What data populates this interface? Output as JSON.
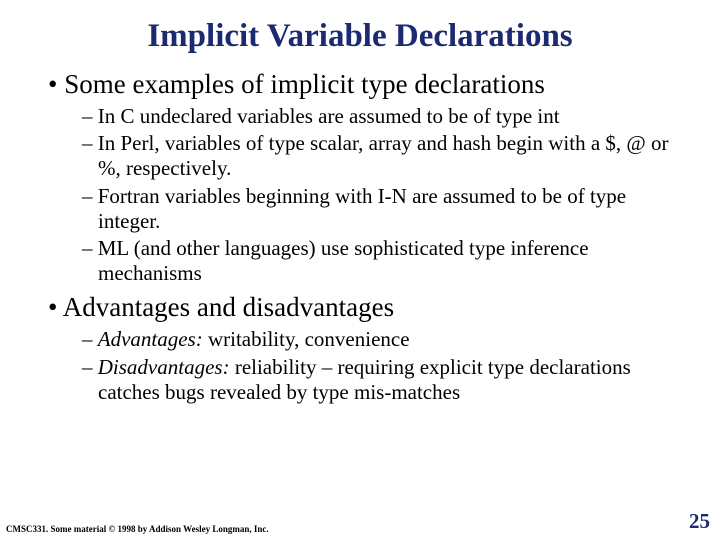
{
  "title": "Implicit Variable Declarations",
  "bullets": {
    "b1": "Some examples of implicit type declarations",
    "b1subs": {
      "s1": "In C undeclared variables are assumed to be of type int",
      "s2": "In Perl, variables of type scalar, array and hash begin with a $, @ or %, respectively.",
      "s3": "Fortran variables beginning with I-N are assumed to be of type integer.",
      "s4": "ML (and other languages) use sophisticated type inference mechanisms"
    },
    "b2": "Advantages and disadvantages",
    "b2subs": {
      "s1_label": "Advantages:",
      "s1_rest": " writability, convenience",
      "s2_label": "Disadvantages:",
      "s2_rest": " reliability – requiring explicit type declarations catches bugs revealed by type mis-matches"
    }
  },
  "footer": {
    "left": "CMSC331. Some material © 1998 by Addison Wesley Longman, Inc.",
    "pagenum": "25"
  }
}
